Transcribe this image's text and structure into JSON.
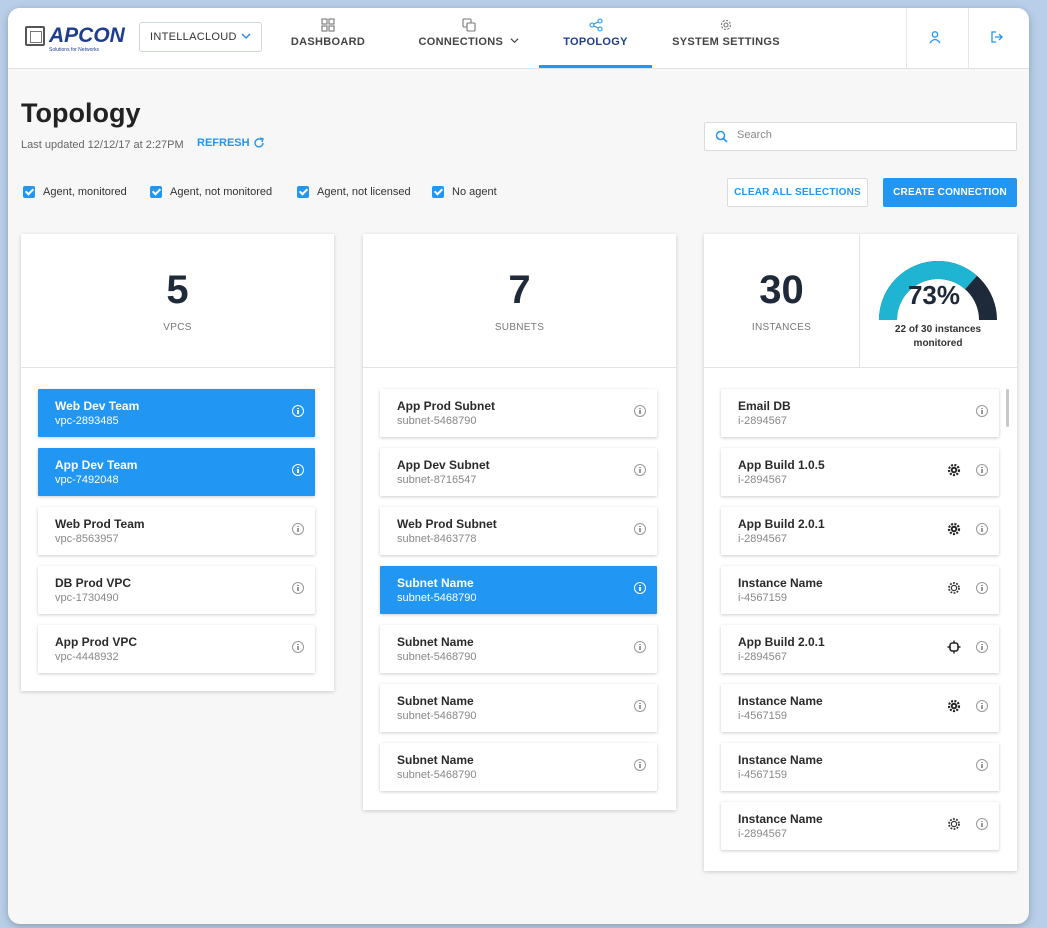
{
  "header": {
    "logo_text": "APCON",
    "logo_tagline": "Solutions for Networks",
    "account": "INTELLACLOUD",
    "nav": [
      {
        "label": "DASHBOARD"
      },
      {
        "label": "CONNECTIONS"
      },
      {
        "label": "TOPOLOGY"
      },
      {
        "label": "SYSTEM SETTINGS"
      }
    ],
    "active_nav": "TOPOLOGY"
  },
  "page": {
    "title": "Topology",
    "last_updated": "Last updated 12/12/17 at 2:27PM",
    "refresh_label": "REFRESH",
    "search_placeholder": "Search"
  },
  "filters": [
    {
      "label": "Agent, monitored",
      "checked": true
    },
    {
      "label": "Agent, not monitored",
      "checked": true
    },
    {
      "label": "Agent, not licensed",
      "checked": true
    },
    {
      "label": "No agent",
      "checked": true
    }
  ],
  "actions": {
    "clear_label": "CLEAR ALL SELECTIONS",
    "create_label": "CREATE CONNECTION"
  },
  "colors": {
    "accent": "#2196f3",
    "gauge_fill": "#1fb4d2",
    "gauge_rest": "#1e2a39"
  },
  "vpcs": {
    "count": "5",
    "label": "VPCS",
    "items": [
      {
        "name": "Web Dev Team",
        "id": "vpc-2893485",
        "selected": true
      },
      {
        "name": "App Dev Team",
        "id": "vpc-7492048",
        "selected": true
      },
      {
        "name": "Web Prod Team",
        "id": "vpc-8563957",
        "selected": false
      },
      {
        "name": "DB Prod VPC",
        "id": "vpc-1730490",
        "selected": false
      },
      {
        "name": "App Prod VPC",
        "id": "vpc-4448932",
        "selected": false
      }
    ]
  },
  "subnets": {
    "count": "7",
    "label": "SUBNETS",
    "items": [
      {
        "name": "App Prod Subnet",
        "id": "subnet-5468790",
        "selected": false
      },
      {
        "name": "App Dev Subnet",
        "id": "subnet-8716547",
        "selected": false
      },
      {
        "name": "Web Prod Subnet",
        "id": "subnet-8463778",
        "selected": false
      },
      {
        "name": "Subnet Name",
        "id": "subnet-5468790",
        "selected": true
      },
      {
        "name": "Subnet Name",
        "id": "subnet-5468790",
        "selected": false
      },
      {
        "name": "Subnet Name",
        "id": "subnet-5468790",
        "selected": false
      },
      {
        "name": "Subnet Name",
        "id": "subnet-5468790",
        "selected": false
      }
    ]
  },
  "instances": {
    "count": "30",
    "label": "INSTANCES",
    "monitored_percent": 73,
    "monitored_percent_label": "73%",
    "monitored_text": "22 of 30 instances monitored",
    "items": [
      {
        "name": "Email DB",
        "id": "i-2894567",
        "agent_icon": "none"
      },
      {
        "name": "App Build 1.0.5",
        "id": "i-2894567",
        "agent_icon": "gear-icon"
      },
      {
        "name": "App Build 2.0.1",
        "id": "i-2894567",
        "agent_icon": "gear-icon"
      },
      {
        "name": "Instance Name",
        "id": "i-4567159",
        "agent_icon": "gear-outline-icon"
      },
      {
        "name": "App Build 2.0.1",
        "id": "i-2894567",
        "agent_icon": "chip-outline-icon"
      },
      {
        "name": "Instance Name",
        "id": "i-4567159",
        "agent_icon": "gear-icon"
      },
      {
        "name": "Instance Name",
        "id": "i-4567159",
        "agent_icon": "none"
      },
      {
        "name": "Instance Name",
        "id": "i-2894567",
        "agent_icon": "gear-outline-icon"
      }
    ]
  }
}
